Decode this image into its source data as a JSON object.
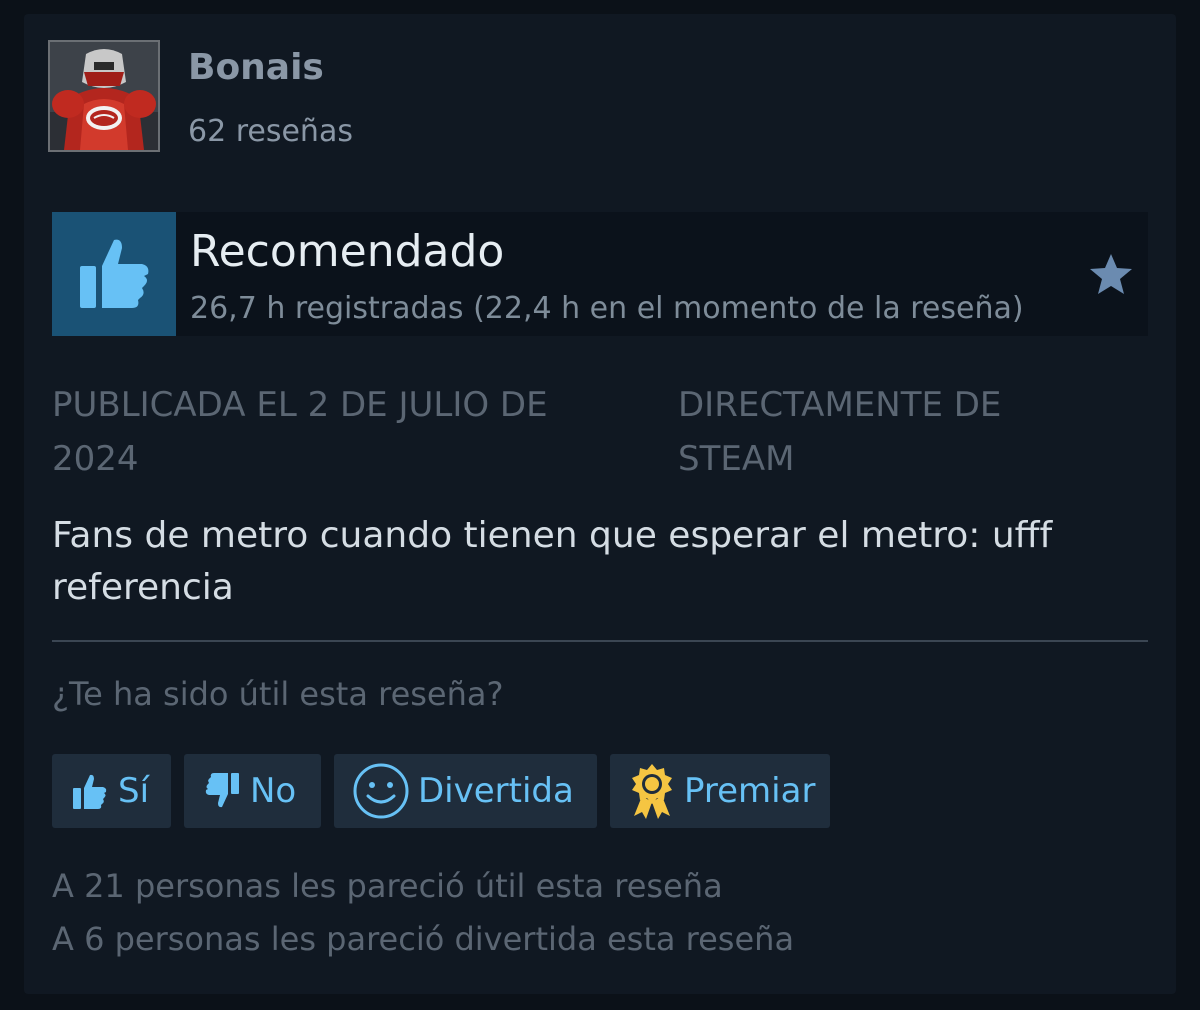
{
  "reviewer": {
    "name": "Bonais",
    "review_count": "62 reseñas"
  },
  "recommendation": {
    "label": "Recomendado",
    "hours": "26,7 h registradas (22,4 h en el momento de la reseña)",
    "thumb_icon": "thumbs-up-icon",
    "star_icon": "star-icon",
    "accent_color": "#1a5275"
  },
  "meta": {
    "posted": "PUBLICADA EL 2 DE JULIO DE 2024",
    "source": "DIRECTAMENTE DE STEAM"
  },
  "review_text": "Fans de metro cuando tienen que esperar el metro: ufff referencia",
  "helpful": {
    "question": "¿Te ha sido útil esta reseña?",
    "buttons": {
      "yes": "Sí",
      "no": "No",
      "funny": "Divertida",
      "award": "Premiar"
    },
    "stats": {
      "helpful": "A 21 personas les pareció útil esta reseña",
      "funny": "A 6 personas les pareció divertida esta reseña"
    }
  },
  "colors": {
    "button_text": "#67c1f5",
    "button_bg": "#1f2d3c",
    "award_gold": "#f5c542"
  }
}
